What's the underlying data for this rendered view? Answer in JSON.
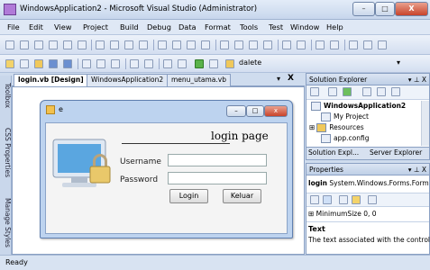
{
  "window": {
    "title": "WindowsApplication2 - Microsoft Visual Studio (Administrator)",
    "min": "–",
    "max": "□",
    "close": "X"
  },
  "menu": [
    "File",
    "Edit",
    "View",
    "Project",
    "Build",
    "Debug",
    "Data",
    "Format",
    "Tools",
    "Test",
    "Window",
    "Help"
  ],
  "toolbar": {
    "combo_value": "dalete"
  },
  "tabs": [
    "login.vb [Design]",
    "WindowsApplication2",
    "menu_utama.vb"
  ],
  "tab_close": "X",
  "toolbox_labels": [
    "Toolbox",
    "CSS Properties",
    "Manage Styles"
  ],
  "form": {
    "title": "e",
    "heading": "login page",
    "username_label": "Username",
    "password_label": "Password",
    "login_button": "Login",
    "exit_button": "Keluar"
  },
  "solution_explorer": {
    "title": "Solution Explorer",
    "pin": "▾ ⊥ X",
    "items": [
      "WindowsApplication2",
      "My Project",
      "Resources",
      "app.config"
    ],
    "tabs": [
      "Solution Expl...",
      "Server Explorer"
    ]
  },
  "properties": {
    "title": "Properties",
    "pin": "▾ ⊥ X",
    "object": "login",
    "object_type": "System.Windows.Forms.Form",
    "row_name": "MinimumSize",
    "row_value": "0, 0",
    "desc_title": "Text",
    "desc_text": "The text associated with the control."
  },
  "status": {
    "text": "Ready"
  }
}
